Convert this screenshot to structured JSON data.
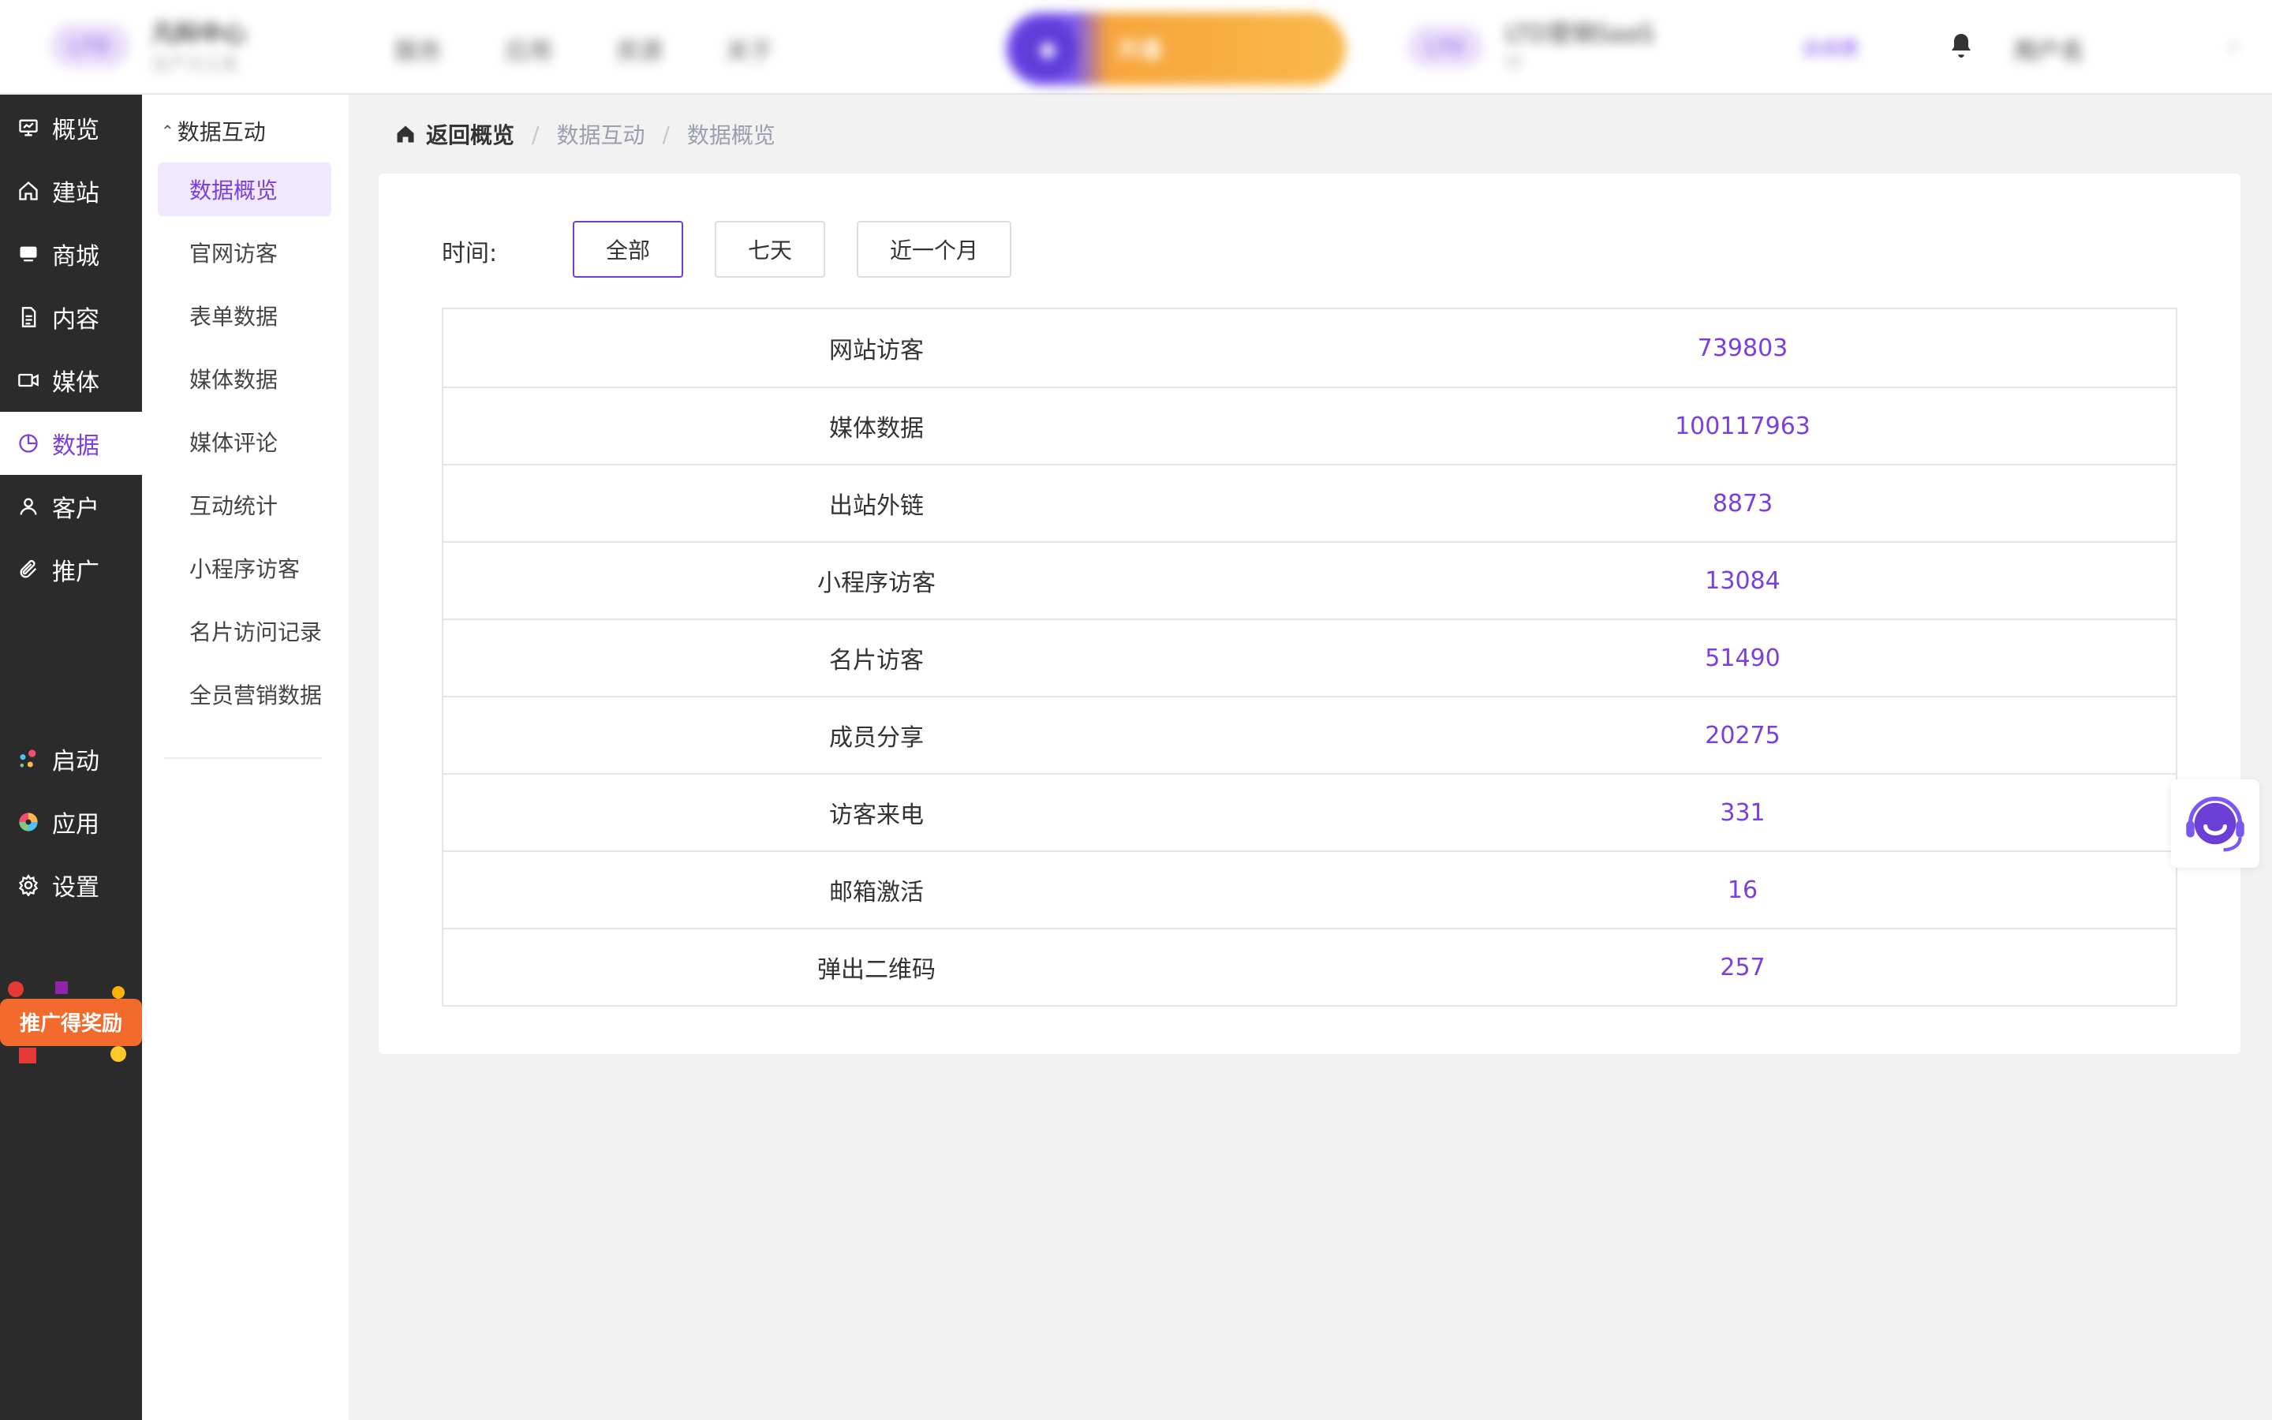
{
  "header": {
    "brand_logo": "LTD",
    "brand_title": "凡科中心",
    "brand_subtitle": "生产力工具",
    "nav": [
      "服务",
      "应用",
      "资源",
      "关于"
    ],
    "promo_text": "开通",
    "account_logo": "LTD",
    "account_name": "LTD营销SaaS",
    "account_sub": "id",
    "account_link": "去续费",
    "user_name": "用户名"
  },
  "sidebar": {
    "items": [
      {
        "label": "概览",
        "icon": "overview-icon"
      },
      {
        "label": "建站",
        "icon": "home-icon"
      },
      {
        "label": "商城",
        "icon": "shop-icon"
      },
      {
        "label": "内容",
        "icon": "document-icon"
      },
      {
        "label": "媒体",
        "icon": "video-icon"
      },
      {
        "label": "数据",
        "icon": "pie-chart-icon"
      },
      {
        "label": "客户",
        "icon": "user-icon"
      },
      {
        "label": "推广",
        "icon": "paperclip-icon"
      }
    ],
    "bottom_items": [
      {
        "label": "启动",
        "icon": "launch-dots-icon"
      },
      {
        "label": "应用",
        "icon": "apps-icon"
      },
      {
        "label": "设置",
        "icon": "gear-icon"
      }
    ],
    "reward_text": "推广得奖励"
  },
  "submenu": {
    "group": "数据互动",
    "items": [
      "数据概览",
      "官网访客",
      "表单数据",
      "媒体数据",
      "媒体评论",
      "互动统计",
      "小程序访客",
      "名片访问记录",
      "全员营销数据"
    ]
  },
  "breadcrumb": [
    "返回概览",
    "数据互动",
    "数据概览"
  ],
  "filter": {
    "label": "时间:",
    "options": [
      "全部",
      "七天",
      "近一个月"
    ]
  },
  "stats": [
    {
      "name": "网站访客",
      "value": "739803"
    },
    {
      "name": "媒体数据",
      "value": "100117963"
    },
    {
      "name": "出站外链",
      "value": "8873"
    },
    {
      "name": "小程序访客",
      "value": "13084"
    },
    {
      "name": "名片访客",
      "value": "51490"
    },
    {
      "name": "成员分享",
      "value": "20275"
    },
    {
      "name": "访客来电",
      "value": "331"
    },
    {
      "name": "邮箱激活",
      "value": "16"
    },
    {
      "name": "弹出二维码",
      "value": "257"
    }
  ],
  "colors": {
    "accent": "#7a3fe0",
    "sidebar_bg": "#2b2b2b",
    "page_bg": "#f2f2f2"
  }
}
